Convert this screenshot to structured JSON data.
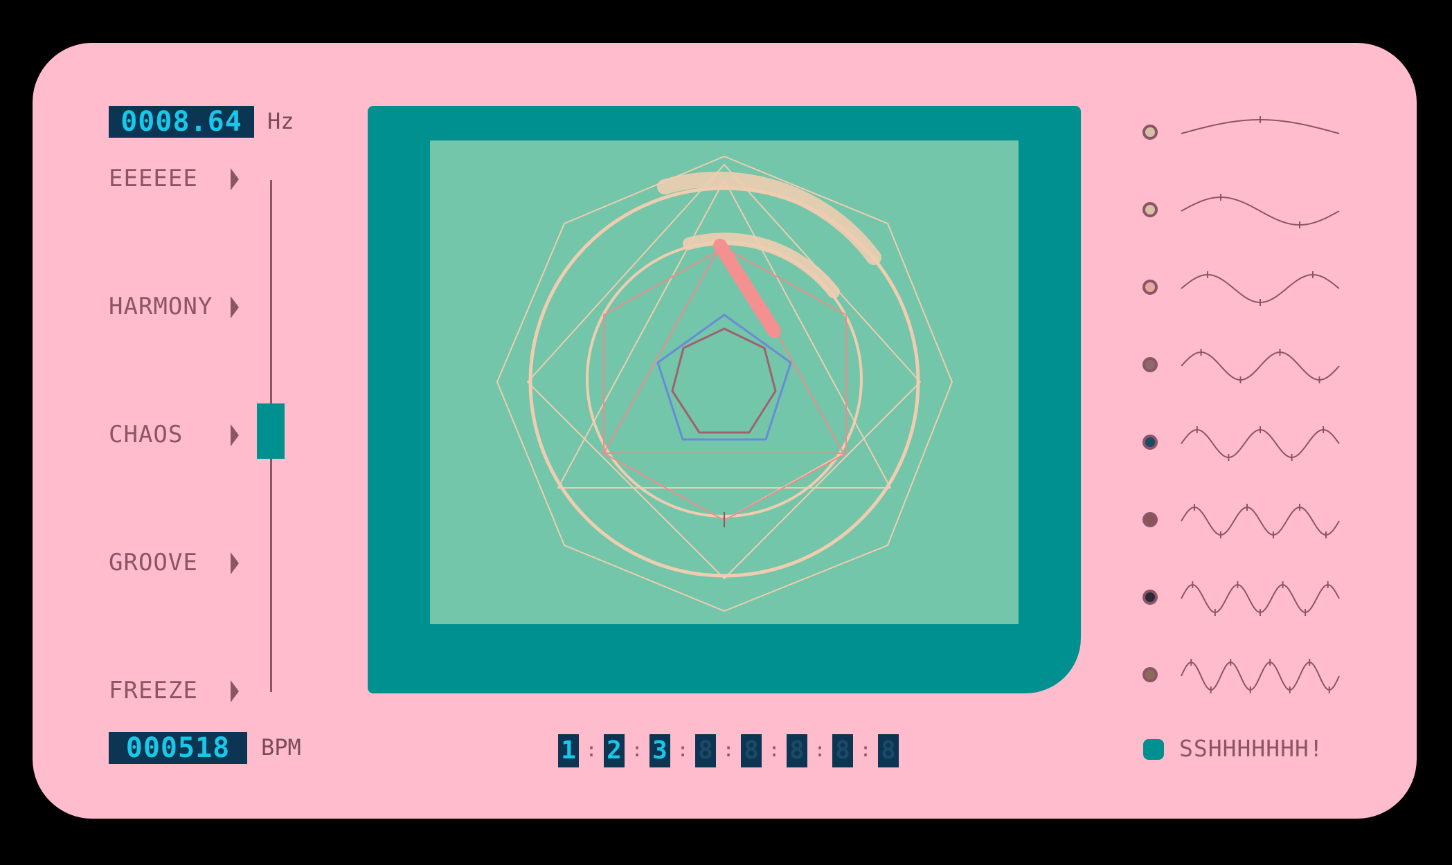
{
  "frequency": {
    "display": "0008.64",
    "unit": "Hz"
  },
  "tempo": {
    "display": "000518",
    "unit": "BPM"
  },
  "modes": [
    {
      "label": "EEEEEE"
    },
    {
      "label": "HARMONY"
    },
    {
      "label": "CHAOS"
    },
    {
      "label": "GROOVE"
    },
    {
      "label": "FREEZE"
    }
  ],
  "mode_slider": {
    "selected": "CHAOS",
    "position_fraction": 0.5
  },
  "sequencer": {
    "steps": [
      "1",
      "2",
      "3",
      "8",
      "8",
      "8",
      "8",
      "8"
    ],
    "active": [
      true,
      true,
      true,
      false,
      false,
      false,
      false,
      false
    ],
    "separator": ":"
  },
  "waveforms": [
    {
      "name": "wave-1",
      "cycles": 0.5,
      "dot_color": "#d8c0a8"
    },
    {
      "name": "wave-2",
      "cycles": 1.0,
      "dot_color": "#d8c0a8"
    },
    {
      "name": "wave-3",
      "cycles": 1.5,
      "dot_color": "#e8a8a0"
    },
    {
      "name": "wave-4",
      "cycles": 2.0,
      "dot_color": "#8c6a6a"
    },
    {
      "name": "wave-5",
      "cycles": 2.5,
      "dot_color": "#1a4a66"
    },
    {
      "name": "wave-6",
      "cycles": 3.0,
      "dot_color": "#8c5555"
    },
    {
      "name": "wave-7",
      "cycles": 3.5,
      "dot_color": "#2a2a3a"
    },
    {
      "name": "wave-8",
      "cycles": 4.0,
      "dot_color": "#8c6a5a"
    }
  ],
  "mute": {
    "label": "SSHHHHHHH!"
  },
  "colors": {
    "panel": "#ffbccd",
    "accent": "#009090",
    "screen": "#73c6a9",
    "lcd_bg": "#0b3552",
    "lcd_text": "#18c8e8",
    "text": "#8c5565",
    "geometry_cream": "#f0cdb0",
    "geometry_pink": "#f08a8a",
    "geometry_blue": "#6a8ad8"
  }
}
